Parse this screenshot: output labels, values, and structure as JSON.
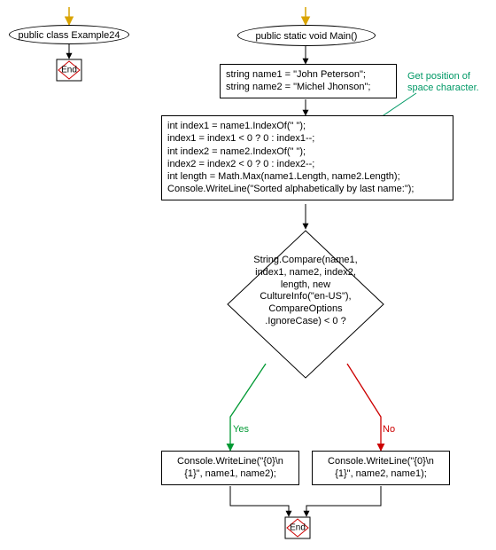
{
  "chart_data": {
    "type": "flowchart",
    "nodes": [
      {
        "id": "class_decl",
        "shape": "ellipse",
        "text": "public class Example24"
      },
      {
        "id": "end1",
        "shape": "end",
        "text": "End"
      },
      {
        "id": "main_decl",
        "shape": "ellipse",
        "text": "public static void Main()"
      },
      {
        "id": "assign_names",
        "shape": "rect",
        "text": "string name1 = \"John Peterson\";\nstring name2 = \"Michel Jhonson\";"
      },
      {
        "id": "index_block",
        "shape": "rect",
        "text": "int index1 = name1.IndexOf(\" \");\nindex1 = index1 < 0 ? 0 : index1--;\nint index2 = name2.IndexOf(\" \");\nindex2 = index2 < 0 ? 0 : index2--;\nint length = Math.Max(name1.Length, name2.Length);\nConsole.WriteLine(\"Sorted alphabetically by last name:\");"
      },
      {
        "id": "compare",
        "shape": "decision",
        "text": "String.Compare(name1, index1, name2, index2, length, new CultureInfo(\"en-US\"), CompareOptions.IgnoreCase) < 0 ?"
      },
      {
        "id": "yes_out",
        "shape": "rect",
        "text": "Console.WriteLine(\"{0}\\n{1}\", name1, name2);"
      },
      {
        "id": "no_out",
        "shape": "rect",
        "text": "Console.WriteLine(\"{0}\\n{1}\", name2, name1);"
      },
      {
        "id": "end2",
        "shape": "end",
        "text": "End"
      }
    ],
    "edges": [
      {
        "from": "__start1__",
        "to": "class_decl",
        "color": "#d9a300"
      },
      {
        "from": "class_decl",
        "to": "end1"
      },
      {
        "from": "__start2__",
        "to": "main_decl",
        "color": "#d9a300"
      },
      {
        "from": "main_decl",
        "to": "assign_names"
      },
      {
        "from": "assign_names",
        "to": "index_block"
      },
      {
        "from": "index_block",
        "to": "compare"
      },
      {
        "from": "compare",
        "to": "yes_out",
        "label": "Yes",
        "color": "#009933"
      },
      {
        "from": "compare",
        "to": "no_out",
        "label": "No",
        "color": "#cc0000"
      },
      {
        "from": "yes_out",
        "to": "end2"
      },
      {
        "from": "no_out",
        "to": "end2"
      }
    ],
    "annotation": {
      "text": "Get position of space character.",
      "target": "index_block",
      "color": "#009966"
    }
  },
  "labels": {
    "class_decl": "public class Example24",
    "end1": "End",
    "main_decl": "public static void Main()",
    "assign_l1": "string name1 = \"John Peterson\";",
    "assign_l2": "string name2 = \"Michel Jhonson\";",
    "idx_l1": "int index1 = name1.IndexOf(\" \");",
    "idx_l2": "index1 = index1 < 0 ? 0 : index1--;",
    "idx_l3": "int index2 = name2.IndexOf(\" \");",
    "idx_l4": "index2 = index2 < 0 ? 0 : index2--;",
    "idx_l5": "int length = Math.Max(name1.Length, name2.Length);",
    "idx_l6": "Console.WriteLine(\"Sorted alphabetically by last name:\");",
    "cmp_l1": "String.Compare(name1,",
    "cmp_l2": "index1, name2, index2,",
    "cmp_l3": "length, new",
    "cmp_l4": "CultureInfo(\"en-US\"),",
    "cmp_l5": "CompareOptions",
    "cmp_l6": ".IgnoreCase) < 0 ?",
    "yes_l1": "Console.WriteLine(\"{0}\\n",
    "yes_l2": "{1}\", name1, name2);",
    "no_l1": "Console.WriteLine(\"{0}\\n",
    "no_l2": "{1}\", name2, name1);",
    "end2": "End",
    "annot_l1": "Get position of",
    "annot_l2": "space character.",
    "yes": "Yes",
    "no": "No"
  }
}
